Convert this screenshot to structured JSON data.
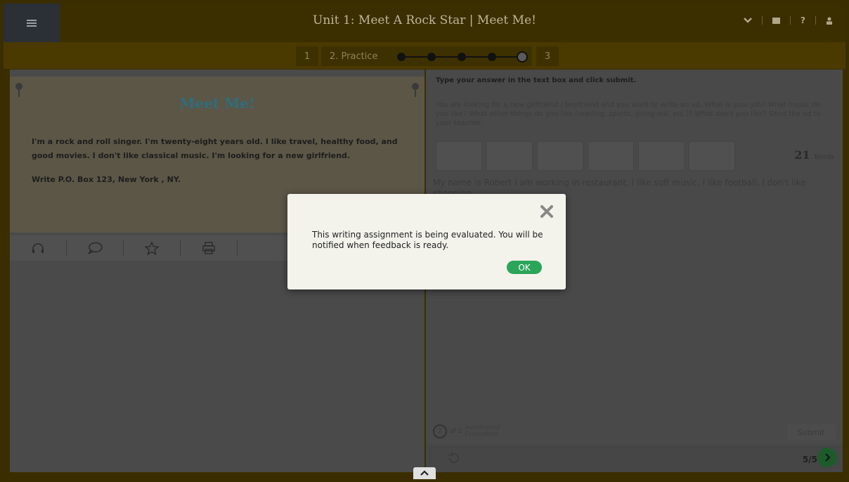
{
  "header": {
    "title": "Unit 1: Meet A Rock Star  |  Meet Me!",
    "icons": [
      "menu-icon",
      "chevron-down-icon",
      "book-icon",
      "help-icon",
      "user-icon"
    ],
    "help_label": "?"
  },
  "steps": {
    "step1": "1",
    "step2": "2. Practice",
    "step3": "3",
    "dots_total": 5,
    "dots_current": 5
  },
  "reading": {
    "title": "Meet Me!",
    "body": "I'm a rock and roll singer. I'm twenty-eight years old. I like travel, healthy food, and good movies. I don't like classical music. I'm looking for a new girlfriend.",
    "address": "Write P.O. Box 123, New York , NY.",
    "tools": [
      "headphones-icon",
      "speech-bubble-icon",
      "star-icon",
      "print-icon"
    ]
  },
  "writing": {
    "instruction": "Type your answer in the text box and click submit.",
    "prompt": "You are looking for a new girlfriend / boyfriend and you want to write an ad. What is your job? What music do you like? What other things do you like (reading, sports, going out, etc.)? What don't you like? Send the ad to your teacher.",
    "word_count": "21",
    "word_label": "Words",
    "answer": "My name is Robert I am working in restaurant, I like soft music, I like football, I don't like shopping",
    "eval_count": "2",
    "eval_of": "of 2",
    "eval_label1": "Automated",
    "eval_label2": "Evaluation",
    "submit_label": "Submit",
    "page": "5/5"
  },
  "modal": {
    "message": "This writing assignment is being evaluated. You will be notified when feedback is ready.",
    "ok_label": "OK"
  },
  "colors": {
    "accent_green": "#2aa55a",
    "title_teal": "#3aa0c0"
  }
}
